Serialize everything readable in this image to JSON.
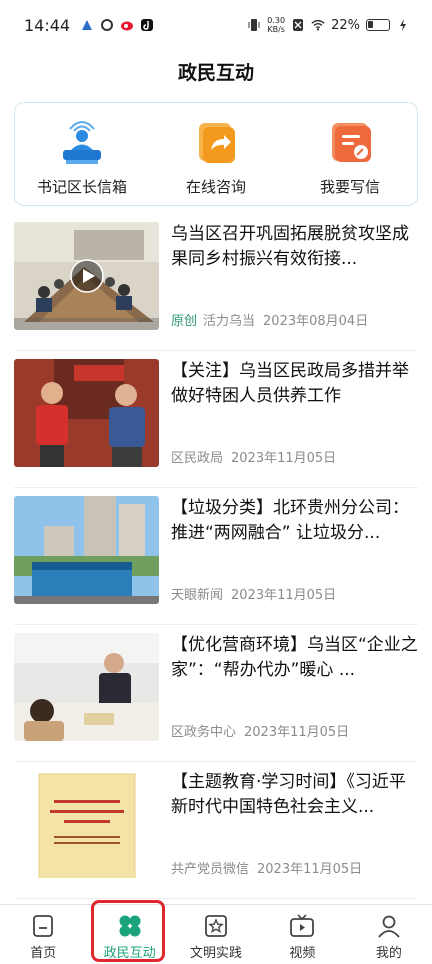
{
  "status_bar": {
    "time": "14:44",
    "net_speed_top": "0.30",
    "net_speed_bottom": "KB/s",
    "battery": "22%"
  },
  "header": {
    "title": "政民互动"
  },
  "quick_actions": [
    {
      "label": "书记区长信箱",
      "icon": "leader-podium-icon",
      "color": "#2a8be0"
    },
    {
      "label": "在线咨询",
      "icon": "consult-share-icon",
      "color": "#f39a1e"
    },
    {
      "label": "我要写信",
      "icon": "write-letter-icon",
      "color": "#ee6a3c"
    }
  ],
  "news": [
    {
      "title": "乌当区召开巩固拓展脱贫攻坚成果同乡村振兴有效衔接...",
      "tag": "原创",
      "source": "活力乌当",
      "date": "2023年08月04日",
      "has_video": true
    },
    {
      "title": "【关注】乌当区民政局多措并举做好特困人员供养工作",
      "tag": "",
      "source": "区民政局",
      "date": "2023年11月05日"
    },
    {
      "title": "【垃圾分类】北环贵州分公司：推进“两网融合” 让垃圾分...",
      "tag": "",
      "source": "天眼新闻",
      "date": "2023年11月05日"
    },
    {
      "title": "【优化营商环境】乌当区“企业之家”：“帮办代办”暖心 ...",
      "tag": "",
      "source": "区政务中心",
      "date": "2023年11月05日"
    },
    {
      "title": "【主题教育·学习时间】《习近平新时代中国特色社会主义...",
      "tag": "",
      "source": "共产党员微信",
      "date": "2023年11月05日"
    }
  ],
  "bottom_nav": [
    {
      "label": "首页",
      "icon": "home-icon"
    },
    {
      "label": "政民互动",
      "icon": "clover-icon",
      "active": true
    },
    {
      "label": "文明实践",
      "icon": "star-frame-icon"
    },
    {
      "label": "视频",
      "icon": "tv-icon"
    },
    {
      "label": "我的",
      "icon": "person-icon"
    }
  ],
  "colors": {
    "accent": "#1aa37a",
    "highlight": "#e0262f",
    "meta": "#8b8b8b"
  }
}
